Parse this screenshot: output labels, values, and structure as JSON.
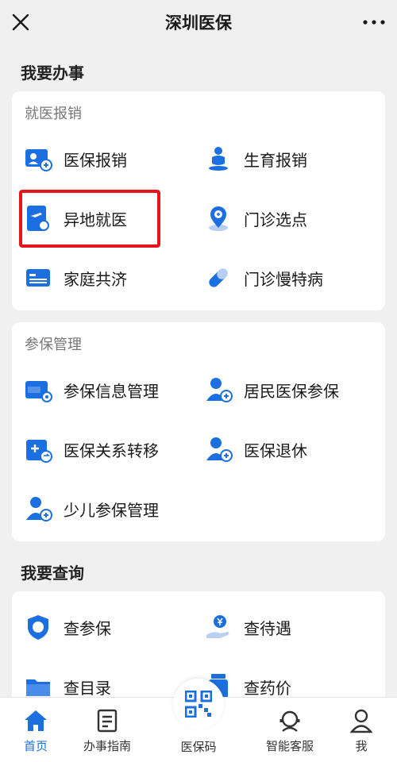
{
  "header": {
    "title": "深圳医保"
  },
  "sections": {
    "todo_title": "我要办事",
    "query_title": "我要查询"
  },
  "medical": {
    "subtitle": "就医报销",
    "items": [
      {
        "label": "医保报销",
        "icon": "reimburse-icon"
      },
      {
        "label": "生育报销",
        "icon": "maternity-icon"
      },
      {
        "label": "异地就医",
        "icon": "remote-medical-icon"
      },
      {
        "label": "门诊选点",
        "icon": "clinic-location-icon"
      },
      {
        "label": "家庭共济",
        "icon": "family-card-icon"
      },
      {
        "label": "门诊慢特病",
        "icon": "pill-icon"
      }
    ]
  },
  "insurance": {
    "subtitle": "参保管理",
    "items": [
      {
        "label": "参保信息管理",
        "icon": "chs-card-icon"
      },
      {
        "label": "居民医保参保",
        "icon": "resident-user-icon"
      },
      {
        "label": "医保关系转移",
        "icon": "transfer-icon"
      },
      {
        "label": "医保退休",
        "icon": "retire-user-icon"
      },
      {
        "label": "少儿参保管理",
        "icon": "child-user-icon"
      }
    ]
  },
  "query": {
    "items": [
      {
        "label": "查参保",
        "icon": "shield-icon"
      },
      {
        "label": "查待遇",
        "icon": "yuan-hand-icon"
      },
      {
        "label": "查目录",
        "icon": "folder-icon"
      },
      {
        "label": "查药价",
        "icon": "medicine-icon"
      }
    ]
  },
  "tabbar": {
    "home": "首页",
    "guide": "办事指南",
    "code": "医保码",
    "service": "智能客服",
    "me": "我"
  },
  "colors": {
    "primary": "#1c6fe0",
    "highlight": "#e8141c"
  }
}
